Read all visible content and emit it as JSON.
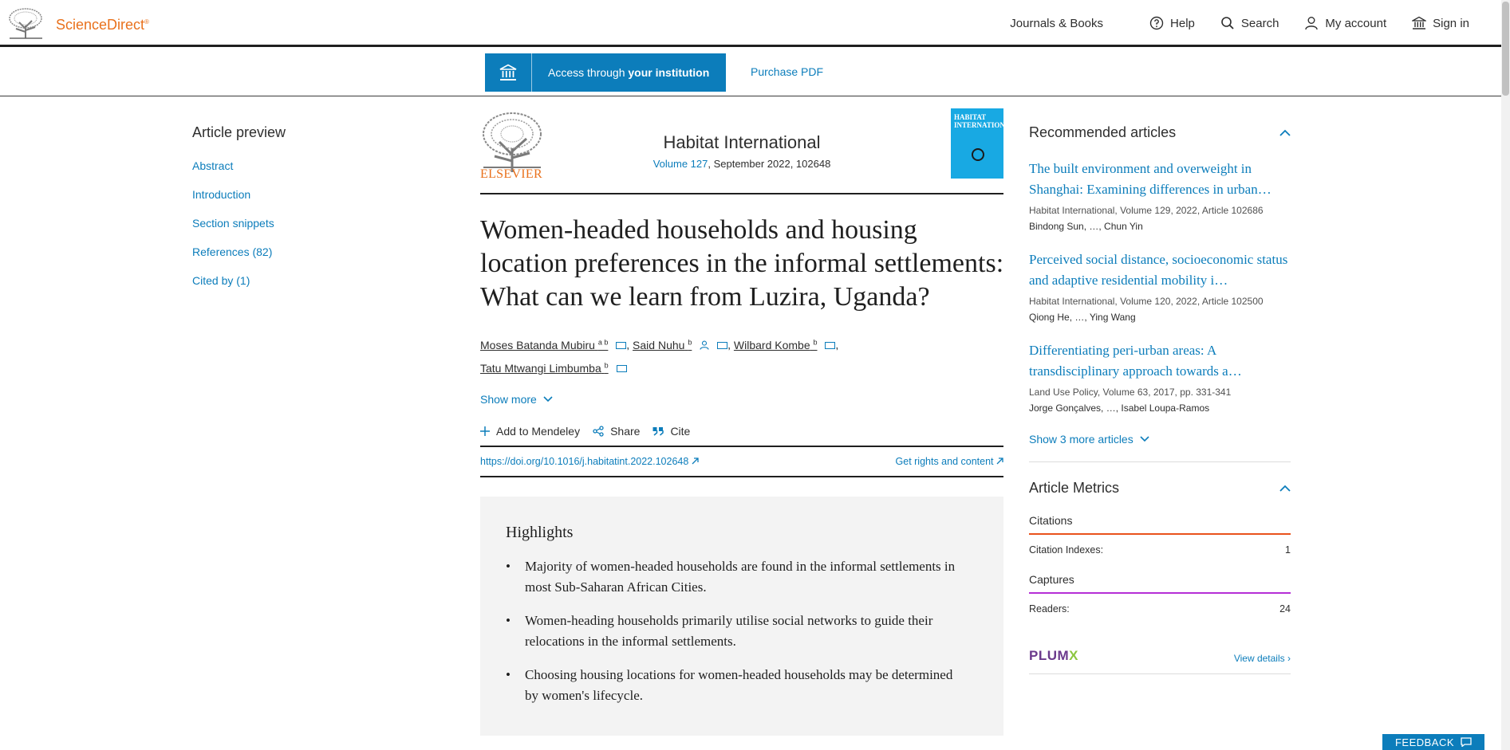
{
  "header": {
    "brand": "ScienceDirect",
    "brand_mark": "®",
    "nav": {
      "journals": "Journals & Books",
      "help": "Help",
      "search": "Search",
      "account": "My account",
      "signin": "Sign in"
    }
  },
  "access": {
    "prefix": "Access through ",
    "bold": "your institution",
    "purchase": "Purchase PDF"
  },
  "toc": {
    "title": "Article preview",
    "items": [
      "Abstract",
      "Introduction",
      "Section snippets",
      "References (82)",
      "Cited by (1)"
    ]
  },
  "journal": {
    "publisher": "ELSEVIER",
    "name": "Habitat International",
    "volume": "Volume 127",
    "meta": ", September 2022, 102648",
    "cover_text": "HABITAT INTERNATIONAL"
  },
  "article": {
    "title": "Women-headed households and housing location preferences in the informal settlements: What can we learn from Luzira, Uganda?",
    "authors": [
      {
        "name": "Moses Batanda Mubiru",
        "sup": "a b"
      },
      {
        "name": "Said Nuhu",
        "sup": "b"
      },
      {
        "name": "Wilbard Kombe",
        "sup": "b"
      },
      {
        "name": "Tatu Mtwangi Limbumba",
        "sup": "b"
      }
    ],
    "sep": ",",
    "show_more": "Show more",
    "actions": {
      "mendeley": "Add to Mendeley",
      "share": "Share",
      "cite": "Cite"
    },
    "doi": "https://doi.org/10.1016/j.habitatint.2022.102648",
    "rights": "Get rights and content"
  },
  "highlights": {
    "title": "Highlights",
    "items": [
      "Majority of women-headed households are found in the informal settlements in most Sub-Saharan African Cities.",
      "Women-heading households primarily utilise social networks to guide their relocations in the informal settlements.",
      "Choosing housing locations for women-headed households may be determined by women's lifecycle."
    ]
  },
  "recommended": {
    "title": "Recommended articles",
    "items": [
      {
        "title": "The built environment and overweight in Shanghai: Examining differences in urban…",
        "meta": "Habitat International, Volume 129, 2022, Article 102686",
        "authors": "Bindong Sun, …, Chun Yin"
      },
      {
        "title": "Perceived social distance, socioeconomic status and adaptive residential mobility i…",
        "meta": "Habitat International, Volume 120, 2022, Article 102500",
        "authors": "Qiong He, …, Ying Wang"
      },
      {
        "title": "Differentiating peri-urban areas: A transdisciplinary approach towards a…",
        "meta": "Land Use Policy, Volume 63, 2017, pp. 331-341",
        "authors": "Jorge Gonçalves, …, Isabel Loupa-Ramos"
      }
    ],
    "show_more": "Show 3 more articles"
  },
  "metrics": {
    "title": "Article Metrics",
    "citations_label": "Citations",
    "citation_indexes_label": "Citation Indexes:",
    "citation_indexes_value": "1",
    "captures_label": "Captures",
    "readers_label": "Readers:",
    "readers_value": "24",
    "plumx_a": "PLUM",
    "plumx_b": "X",
    "view_details": "View details"
  },
  "feedback": "FEEDBACK",
  "colors": {
    "accent": "#0c7dbb",
    "brand": "#e9711c",
    "citations_line": "#e9521c",
    "captures_line": "#b52fd6"
  }
}
